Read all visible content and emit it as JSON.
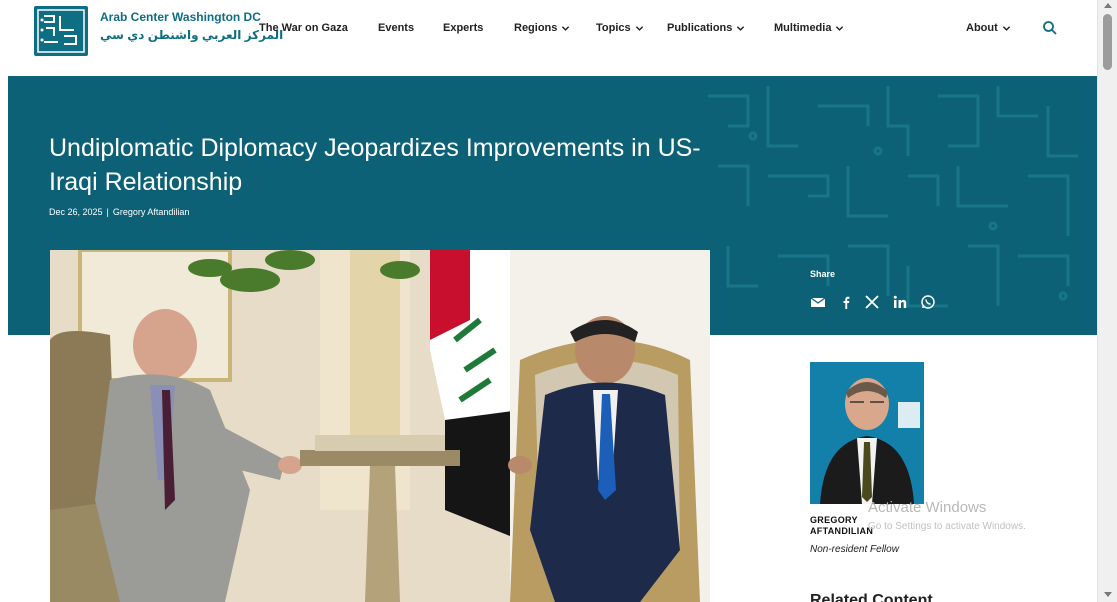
{
  "header": {
    "brand_en": "Arab Center Washington DC",
    "brand_ar": "المركز العربي واشنطن دي سي",
    "logo_icon": "acw-logo-icon",
    "nav": [
      {
        "label": "The War on Gaza",
        "dropdown": false
      },
      {
        "label": "Events",
        "dropdown": false
      },
      {
        "label": "Experts",
        "dropdown": false
      },
      {
        "label": "Regions",
        "dropdown": true
      },
      {
        "label": "Topics",
        "dropdown": true
      },
      {
        "label": "Publications",
        "dropdown": true
      },
      {
        "label": "Multimedia",
        "dropdown": true
      },
      {
        "label": "About",
        "dropdown": true
      }
    ],
    "search_icon": "search-icon"
  },
  "article": {
    "title": "Undiplomatic Diplomacy Jeopardizes Improvements in US-Iraqi Relationship",
    "date": "Dec 26, 2025",
    "separator": "|",
    "author": "Gregory Aftandilian"
  },
  "share": {
    "label": "Share",
    "icons": [
      "email-icon",
      "facebook-icon",
      "x-icon",
      "linkedin-icon",
      "whatsapp-icon"
    ]
  },
  "author_card": {
    "name": "GREGORY AFTANDILIAN",
    "role": "Non-resident Fellow"
  },
  "sidebar": {
    "related_heading": "Related Content"
  },
  "watermark": {
    "title": "Activate Windows",
    "subtitle": "Go to Settings to activate Windows."
  },
  "colors": {
    "brand_teal": "#0e6e83",
    "hero_bg": "#0c6176"
  }
}
